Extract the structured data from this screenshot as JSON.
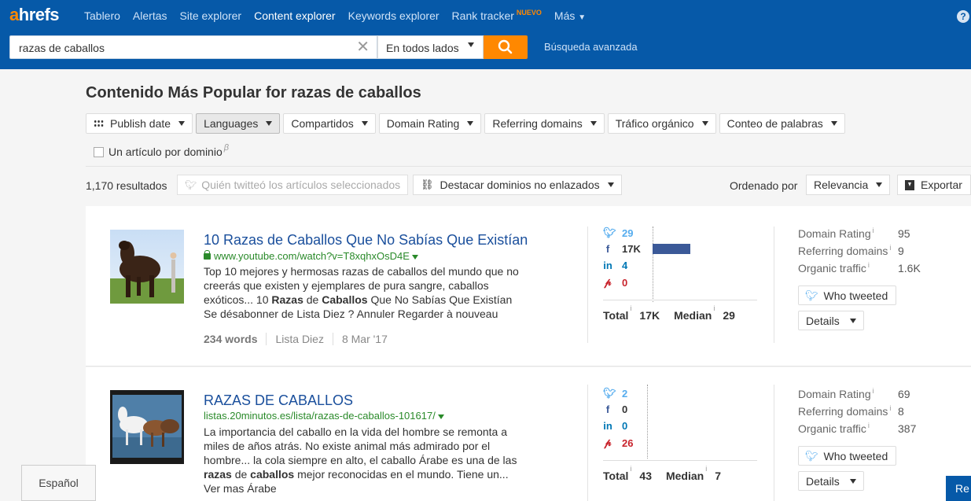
{
  "app": {
    "logo_prefix": "a",
    "logo_rest": "hrefs",
    "nav": [
      {
        "label": "Tablero"
      },
      {
        "label": "Alertas"
      },
      {
        "label": "Site explorer"
      },
      {
        "label": "Content explorer"
      },
      {
        "label": "Keywords explorer"
      },
      {
        "label": "Rank tracker",
        "badge": "NUEVO"
      },
      {
        "label": "Más"
      }
    ],
    "help_icon": "?"
  },
  "search": {
    "value": "razas de caballos",
    "scope": "En todos lados",
    "advanced": "Búsqueda avanzada"
  },
  "page": {
    "title": "Contenido Más Popular for razas de caballos",
    "filters": [
      {
        "label": "Publish date"
      },
      {
        "label": "Languages"
      },
      {
        "label": "Compartidos"
      },
      {
        "label": "Domain Rating"
      },
      {
        "label": "Referring domains"
      },
      {
        "label": "Tráfico orgánico"
      },
      {
        "label": "Conteo de palabras"
      }
    ],
    "one_per_domain": "Un artículo por dominio",
    "beta_mark": "β",
    "results": "1,170 resultados",
    "who_tweeted_selected": "Quién twitteó los artículos seleccionados",
    "highlight": "Destacar dominios no enlazados",
    "sort_label": "Ordenado por",
    "sort_value": "Relevancia",
    "export": "Exportar"
  },
  "results": [
    {
      "title": "10 Razas de Caballos Que No Sabías Que Existían",
      "url": "www.youtube.com/watch?v=T8xqhxOsD4E",
      "secure": true,
      "snippet_parts": [
        {
          "t": "Top 10 mejores y hermosas razas de caballos del mundo que no creerás que existen y ejemplares de pura sangre, caballos exóticos... 10 "
        },
        {
          "t": "Razas",
          "b": true
        },
        {
          "t": " de "
        },
        {
          "t": "Caballos",
          "b": true
        },
        {
          "t": " Que No Sabías Que Existían Se désabonner de Lista Diez ? Annuler Regarder à nouveau"
        }
      ],
      "words": "234 words",
      "author": "Lista Diez",
      "date": "8 Mar '17",
      "social": {
        "twitter": "29",
        "facebook": "17K",
        "linkedin": "4",
        "pinterest": "0"
      },
      "facebook_share": 1.0,
      "total_label": "Total",
      "total": "17K",
      "median_label": "Median",
      "median": "29",
      "metrics": [
        {
          "label": "Domain Rating",
          "value": "95"
        },
        {
          "label": "Referring domains",
          "value": "9"
        },
        {
          "label": "Organic traffic",
          "value": "1.6K"
        }
      ],
      "who_tweeted": "Who tweeted",
      "details": "Details"
    },
    {
      "title": "RAZAS DE CABALLOS",
      "url": "listas.20minutos.es/lista/razas-de-caballos-101617/",
      "secure": false,
      "snippet_parts": [
        {
          "t": "La importancia del caballo en la vida del hombre se remonta a miles de años atrás. No existe animal más admirado por el hombre... la cola siempre en alto, el caballo Árabe es una de las "
        },
        {
          "t": "razas",
          "b": true
        },
        {
          "t": " de "
        },
        {
          "t": "caballos",
          "b": true
        },
        {
          "t": " mejor reconocidas en el mundo. Tiene un... Ver mas Árabe"
        }
      ],
      "social": {
        "twitter": "2",
        "facebook": "0",
        "linkedin": "0",
        "pinterest": "26"
      },
      "total_label": "Total",
      "total": "43",
      "median_label": "Median",
      "median": "7",
      "metrics": [
        {
          "label": "Domain Rating",
          "value": "69"
        },
        {
          "label": "Referring domains",
          "value": "8"
        },
        {
          "label": "Organic traffic",
          "value": "387"
        }
      ],
      "who_tweeted": "Who tweeted",
      "details": "Details"
    }
  ],
  "footer": {
    "language": "Español",
    "re_button": "Re"
  },
  "colors": {
    "brand_blue": "#0659a8",
    "accent_orange": "#ff8800",
    "link_blue": "#1a4f9c",
    "url_green": "#2a8a2a"
  }
}
